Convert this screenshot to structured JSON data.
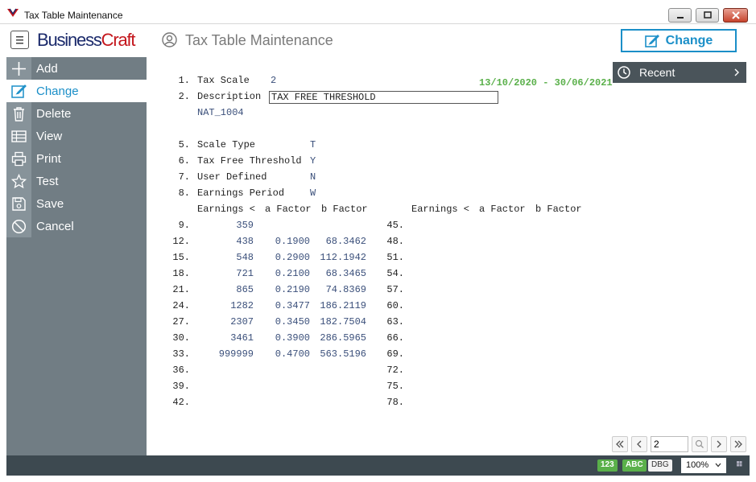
{
  "window": {
    "title": "Tax Table Maintenance",
    "controls": {
      "minimize": "minimize-icon",
      "restore": "restore-icon",
      "close": "close-icon"
    }
  },
  "header": {
    "brand_part1": "Business",
    "brand_part2": "Craft",
    "screen_title": "Tax Table Maintenance",
    "mode_button": "Change",
    "colors": {
      "accent": "#1b8fc8",
      "brand_navy": "#1b2a6b",
      "brand_red": "#c4161c"
    }
  },
  "sidebar": {
    "items": [
      {
        "label": "Add",
        "icon": "plus-icon",
        "active": false
      },
      {
        "label": "Change",
        "icon": "edit-icon",
        "active": true
      },
      {
        "label": "Delete",
        "icon": "trash-icon",
        "active": false
      },
      {
        "label": "View",
        "icon": "table-icon",
        "active": false
      },
      {
        "label": "Print",
        "icon": "printer-icon",
        "active": false
      },
      {
        "label": "Test",
        "icon": "star-icon",
        "active": false
      },
      {
        "label": "Save",
        "icon": "floppy-icon",
        "active": false
      },
      {
        "label": "Cancel",
        "icon": "cancel-icon",
        "active": false
      }
    ]
  },
  "form": {
    "date_range": "13/10/2020 - 30/06/2021",
    "fields": [
      {
        "num": "1.",
        "label": "Tax Scale",
        "value": "2"
      },
      {
        "num": "2.",
        "label": "Description",
        "value": "TAX FREE THRESHOLD"
      }
    ],
    "sub_value": "NAT_1004",
    "flags": [
      {
        "num": "5.",
        "label": "Scale Type",
        "value": "T"
      },
      {
        "num": "6.",
        "label": "Tax Free Threshold",
        "value": "Y"
      },
      {
        "num": "7.",
        "label": "User Defined",
        "value": "N"
      },
      {
        "num": "8.",
        "label": "Earnings Period",
        "value": "W"
      }
    ],
    "table_headers": [
      "Earnings <",
      "a Factor",
      "b Factor"
    ],
    "left_rows": [
      {
        "num": "9.",
        "earnings": "359",
        "a": "",
        "b": ""
      },
      {
        "num": "12.",
        "earnings": "438",
        "a": "0.1900",
        "b": "68.3462"
      },
      {
        "num": "15.",
        "earnings": "548",
        "a": "0.2900",
        "b": "112.1942"
      },
      {
        "num": "18.",
        "earnings": "721",
        "a": "0.2100",
        "b": "68.3465"
      },
      {
        "num": "21.",
        "earnings": "865",
        "a": "0.2190",
        "b": "74.8369"
      },
      {
        "num": "24.",
        "earnings": "1282",
        "a": "0.3477",
        "b": "186.2119"
      },
      {
        "num": "27.",
        "earnings": "2307",
        "a": "0.3450",
        "b": "182.7504"
      },
      {
        "num": "30.",
        "earnings": "3461",
        "a": "0.3900",
        "b": "286.5965"
      },
      {
        "num": "33.",
        "earnings": "999999",
        "a": "0.4700",
        "b": "563.5196"
      },
      {
        "num": "36.",
        "earnings": "",
        "a": "",
        "b": ""
      },
      {
        "num": "39.",
        "earnings": "",
        "a": "",
        "b": ""
      },
      {
        "num": "42.",
        "earnings": "",
        "a": "",
        "b": ""
      }
    ],
    "right_rows": [
      {
        "num": "45."
      },
      {
        "num": "48."
      },
      {
        "num": "51."
      },
      {
        "num": "54."
      },
      {
        "num": "57."
      },
      {
        "num": "60."
      },
      {
        "num": "63."
      },
      {
        "num": "66."
      },
      {
        "num": "69."
      },
      {
        "num": "72."
      },
      {
        "num": "75."
      },
      {
        "num": "78."
      }
    ]
  },
  "recent": {
    "label": "Recent"
  },
  "pager": {
    "page": "2"
  },
  "footer": {
    "badges": [
      "123",
      "ABC",
      "DBG"
    ],
    "zoom": "100%"
  }
}
